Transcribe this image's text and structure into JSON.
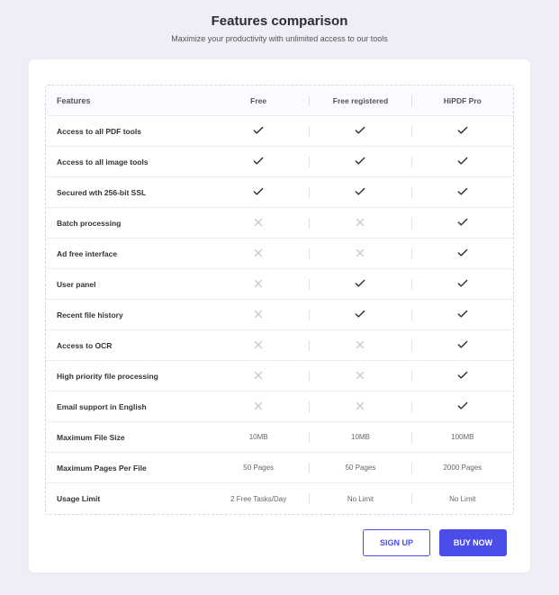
{
  "header": {
    "title": "Features comparison",
    "subtitle": "Maximize your productivity with unlimited access to our tools"
  },
  "columns": {
    "feature": "Features",
    "plans": [
      "Free",
      "Free registered",
      "HiPDF Pro"
    ]
  },
  "rows": [
    {
      "label": "Access to all PDF tools",
      "values": [
        "check",
        "check",
        "check"
      ]
    },
    {
      "label": "Access to all image tools",
      "values": [
        "check",
        "check",
        "check"
      ]
    },
    {
      "label": "Secured wth 256-bit SSL",
      "values": [
        "check",
        "check",
        "check"
      ]
    },
    {
      "label": "Batch processing",
      "values": [
        "x",
        "x",
        "check"
      ]
    },
    {
      "label": "Ad free interface",
      "values": [
        "x",
        "x",
        "check"
      ]
    },
    {
      "label": "User panel",
      "values": [
        "x",
        "check",
        "check"
      ]
    },
    {
      "label": "Recent file history",
      "values": [
        "x",
        "check",
        "check"
      ]
    },
    {
      "label": "Access to OCR",
      "values": [
        "x",
        "x",
        "check"
      ]
    },
    {
      "label": "High priority file processing",
      "values": [
        "x",
        "x",
        "check"
      ]
    },
    {
      "label": "Email support in English",
      "values": [
        "x",
        "x",
        "check"
      ]
    },
    {
      "label": "Maximum File Size",
      "values": [
        "10MB",
        "10MB",
        "100MB"
      ]
    },
    {
      "label": "Maximum Pages Per File",
      "values": [
        "50 Pages",
        "50 Pages",
        "2000 Pages"
      ]
    },
    {
      "label": "Usage Limit",
      "values": [
        "2 Free Tasks/Day",
        "No Limit",
        "No Limit"
      ]
    }
  ],
  "actions": {
    "signup": "SIGN UP",
    "buy": "BUY NOW"
  }
}
